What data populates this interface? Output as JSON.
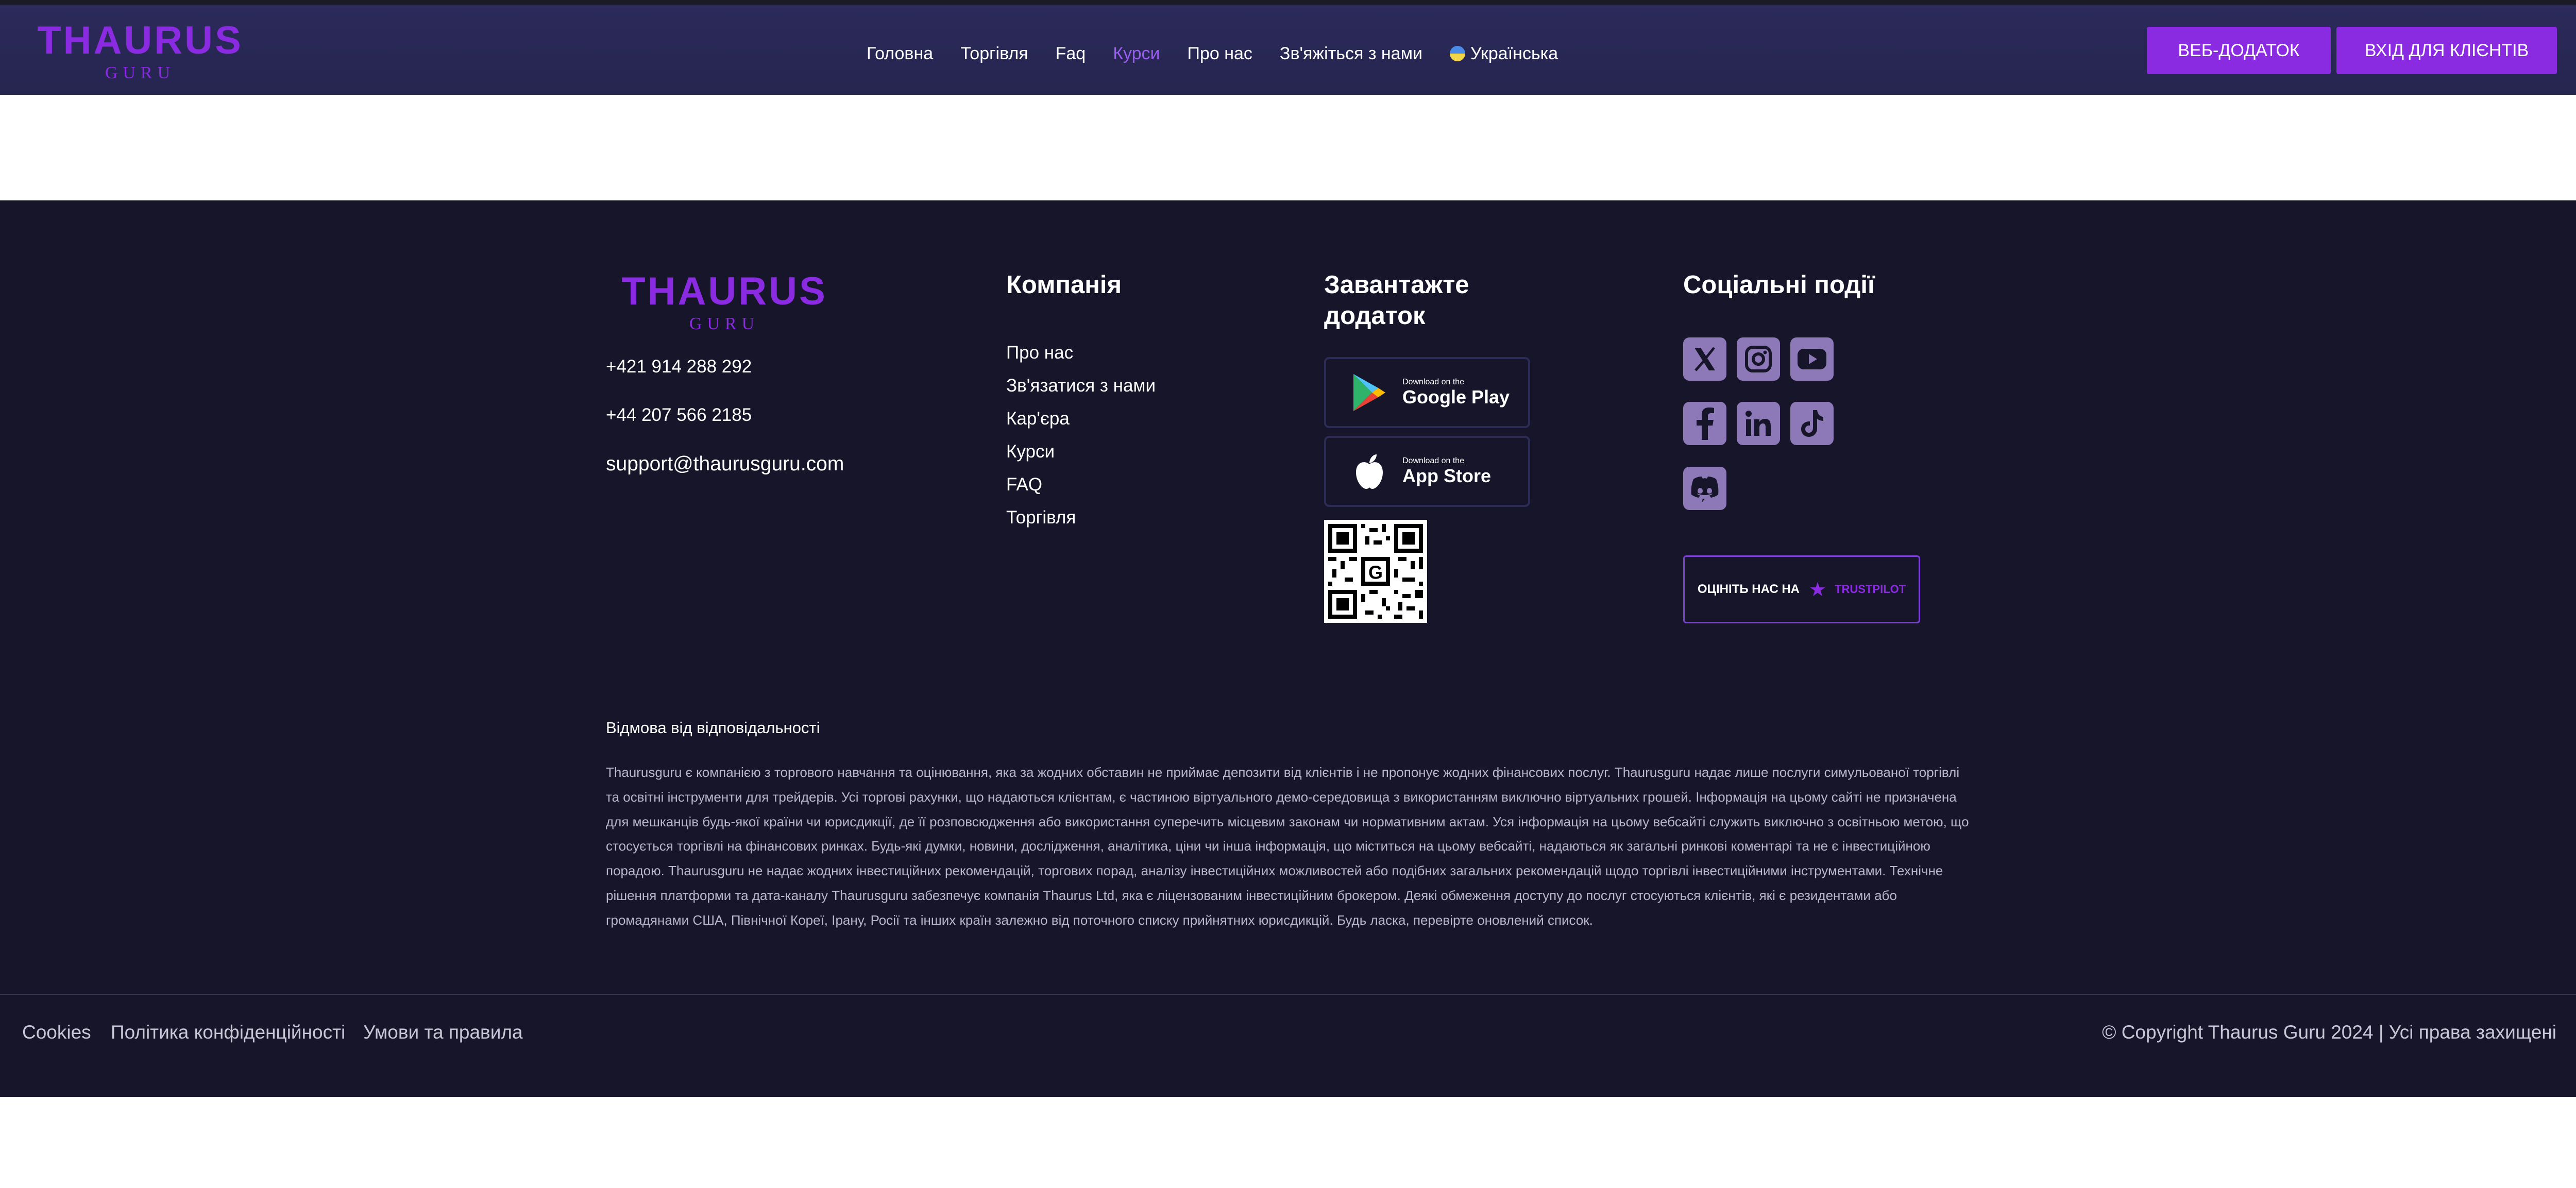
{
  "brand": {
    "name": "THAURUS",
    "sub": "GURU",
    "color": "#8a2be2"
  },
  "nav": {
    "items": [
      {
        "label": "Головна",
        "active": false
      },
      {
        "label": "Торгівля",
        "active": false
      },
      {
        "label": "Faq",
        "active": false
      },
      {
        "label": "Курси",
        "active": true
      },
      {
        "label": "Про нас",
        "active": false
      },
      {
        "label": "Зв'яжіться з нами",
        "active": false
      }
    ],
    "language": "Українська"
  },
  "buttons": {
    "web_app": "ВЕБ-ДОДАТОК",
    "client_login": "ВХІД ДЛЯ КЛІЄНТІВ"
  },
  "footer": {
    "contacts": {
      "phone1": "+421 914 288 292",
      "phone2": "+44 207 566 2185",
      "email": "support@thaurusguru.com"
    },
    "company": {
      "title": "Компанія",
      "links": [
        "Про нас",
        "Зв'язатися з нами",
        "Кар'єра",
        "Курси",
        "FAQ",
        "Торгівля"
      ]
    },
    "download": {
      "title_line1": "Завантажте",
      "title_line2": "додаток",
      "google_small": "Download on the",
      "google_big": "Google Play",
      "apple_small": "Download on the",
      "apple_big": "App Store"
    },
    "social": {
      "title": "Соціальні події",
      "icons": [
        "x-icon",
        "instagram-icon",
        "youtube-icon",
        "facebook-icon",
        "linkedin-icon",
        "tiktok-icon",
        "discord-icon"
      ],
      "trust_prefix": "Оцініть нас на",
      "trust_brand": "Trustpilot"
    },
    "disclaimer": {
      "title": "Відмова від відповідальності",
      "text": "Thaurusguru є компанією з торгового навчання та оцінювання, яка за жодних обставин не приймає депозити від клієнтів і не пропонує жодних фінансових послуг. Thaurusguru надає лише послуги симульованої торгівлі та освітні інструменти для трейдерів. Усі торгові рахунки, що надаються клієнтам, є частиною віртуального демо-середовища з використанням виключно віртуальних грошей. Інформація на цьому сайті не призначена для мешканців будь-якої країни чи юрисдикції, де її розповсюдження або використання суперечить місцевим законам чи нормативним актам. Уся інформація на цьому вебсайті служить виключно з освітньою метою, що стосується торгівлі на фінансових ринках. Будь-які думки, новини, дослідження, аналітика, ціни чи інша інформація, що міститься на цьому вебсайті, надаються як загальні ринкові коментарі та не є інвестиційною порадою. Thaurusguru не надає жодних інвестиційних рекомендацій, торгових порад, аналізу інвестиційних можливостей або подібних загальних рекомендацій щодо торгівлі інвестиційними інструментами. Технічне рішення платформи та дата-каналу Thaurusguru забезпечує компанія Thaurus Ltd, яка є ліцензованим інвестиційним брокером. Деякі обмеження доступу до послуг стосуються клієнтів, які є резидентами або громадянами США, Північної Кореї, Ірану, Росії та інших країн залежно від поточного списку прийнятних юрисдикцій. Будь ласка, перевірте оновлений список."
    },
    "bottom": {
      "cookies": "Cookies",
      "privacy": "Політика конфіденційності",
      "terms": "Умови та правила",
      "copyright": "© Copyright Thaurus Guru 2024 | Усі права захищені"
    }
  }
}
